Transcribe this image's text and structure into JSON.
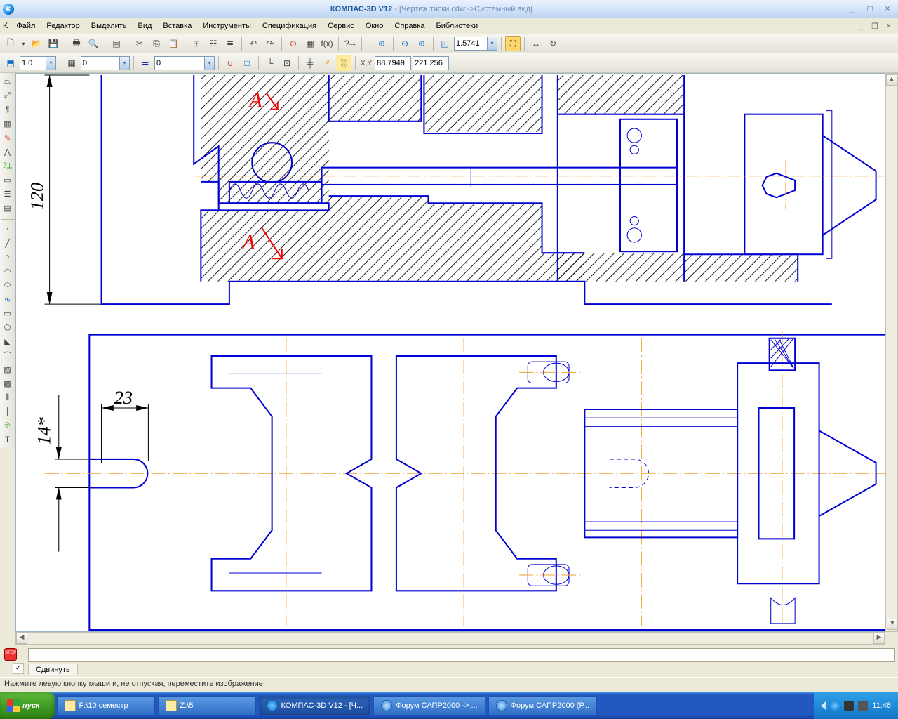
{
  "title": {
    "app": "КОМПАС-3D V12",
    "sep": " - ",
    "doc": "[Чертеж тиски.cdw ->Системный вид]"
  },
  "menu": {
    "file": "Файл",
    "edit": "Редактор",
    "select": "Выделить",
    "view": "Вид",
    "insert": "Вставка",
    "tools": "Инструменты",
    "spec": "Спецификация",
    "service": "Сервис",
    "window": "Окно",
    "help": "Справка",
    "libs": "Библиотеки"
  },
  "toolbar2": {
    "zoom_combo": "1.5741",
    "xcoord": "88.7949",
    "ycoord": "221.256"
  },
  "toolbar3": {
    "linewidth": "1.0",
    "layer": "0",
    "style": "0"
  },
  "drawing": {
    "dim_120": "120",
    "dim_14": "14*",
    "dim_23": "23",
    "ann_A_top": "А",
    "ann_A_bot": "А"
  },
  "command_tabs": {
    "move": "Сдвинуть"
  },
  "status": "Нажмите левую кнопку мыши и, не отпуская, переместите изображение",
  "taskbar": {
    "start": "пуск",
    "items": [
      {
        "label": "F:\\10 семестр"
      },
      {
        "label": "Z:\\5"
      },
      {
        "label": "КОМПАС-3D V12 - [Ч..."
      },
      {
        "label": "Форум САПР2000 -> ..."
      },
      {
        "label": "Форум САПР2000 (Р..."
      }
    ],
    "clock": "11:46"
  }
}
